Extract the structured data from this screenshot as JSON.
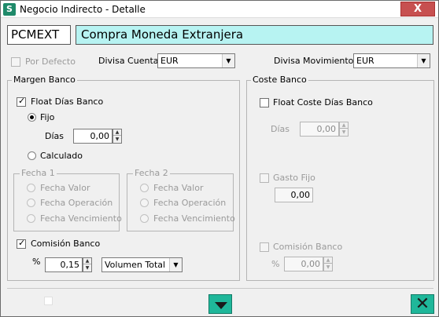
{
  "window": {
    "title": "Negocio Indirecto - Detalle",
    "close_symbol": "X"
  },
  "header": {
    "code": "PCMEXT",
    "name": "Compra Moneda Extranjera"
  },
  "top": {
    "por_defecto_label": "Por Defecto",
    "divisa_cuenta_label": "Divisa Cuenta:",
    "divisa_cuenta_value": "EUR",
    "divisa_mov_label": "Divisa Movimientos:",
    "divisa_mov_value": "EUR"
  },
  "margen": {
    "title": "Margen Banco",
    "float_label": "Float Días Banco",
    "float_checked": true,
    "fijo_label": "Fijo",
    "dias_label": "Días",
    "dias_value": "0,00",
    "calculado_label": "Calculado",
    "fecha1": {
      "title": "Fecha 1",
      "opt1": "Fecha Valor",
      "opt2": "Fecha Operación",
      "opt3": "Fecha Vencimiento"
    },
    "fecha2": {
      "title": "Fecha 2",
      "opt1": "Fecha Valor",
      "opt2": "Fecha Operación",
      "opt3": "Fecha Vencimiento"
    },
    "comision_label": "Comisión Banco",
    "comision_checked": true,
    "pct_label": "%",
    "pct_value": "0,15",
    "volumen_value": "Volumen Total"
  },
  "coste": {
    "title": "Coste Banco",
    "float_label": "Float Coste Días Banco",
    "dias_label": "Días",
    "dias_value": "0,00",
    "gasto_label": "Gasto Fijo",
    "gasto_value": "0,00",
    "comision_label": "Comisión Banco",
    "pct_label": "%",
    "pct_value": "0,00"
  },
  "footer": {
    "accept_icon": "chevron-down-icon",
    "cancel_icon": "close-icon",
    "cancel_symbol": "✕"
  }
}
